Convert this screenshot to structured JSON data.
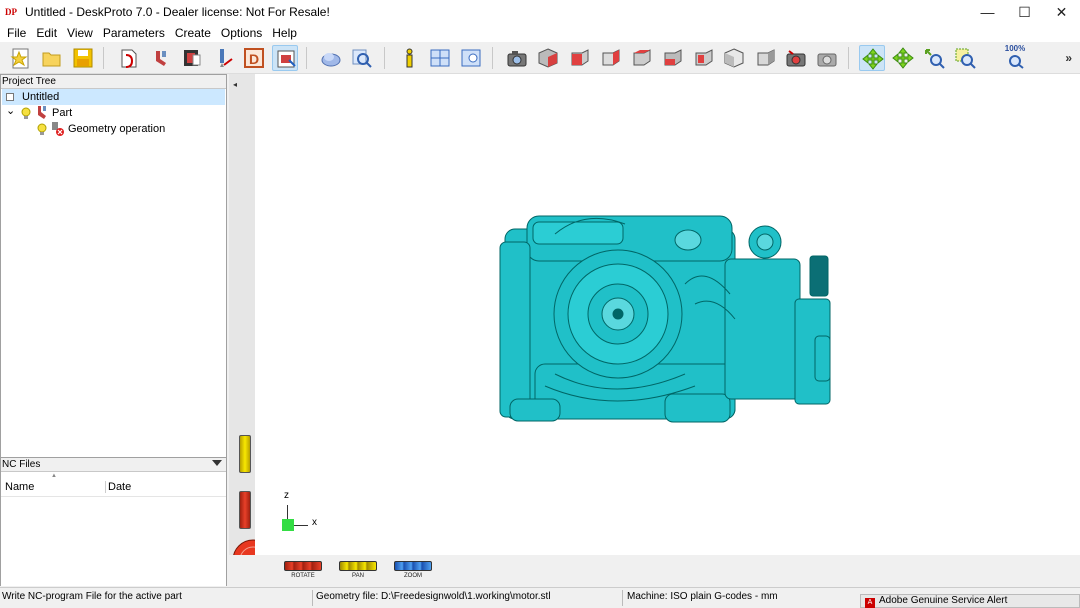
{
  "window": {
    "logo_text": "DP",
    "title": "Untitled - DeskProto 7.0 - Dealer license: Not For Resale!",
    "minimize": "—",
    "maximize": "☐",
    "close": "✕"
  },
  "menu": {
    "items": [
      "File",
      "Edit",
      "View",
      "Parameters",
      "Create",
      "Options",
      "Help"
    ]
  },
  "toolbar": {
    "zoom_100_label": "100%",
    "overflow": "»"
  },
  "project_tree": {
    "header": "Project Tree",
    "items": [
      {
        "label": "Untitled"
      },
      {
        "label": "Part",
        "expander": "⌄"
      },
      {
        "label": "Geometry operation"
      }
    ]
  },
  "nc_files": {
    "header": "NC Files",
    "columns": [
      "Name",
      "Date"
    ]
  },
  "viewport": {
    "collapse": "◂",
    "axis_z": "z",
    "axis_x": "x",
    "model_color": "#20c0c8"
  },
  "mouse_legend": {
    "rotate": "ROTATE",
    "pan": "PAN",
    "zoom": "ZOOM"
  },
  "status": {
    "hint": "Write NC-program File for the active part",
    "geometry": "Geometry file: D:\\Freedesignwold\\1.working\\motor.stl",
    "machine": "Machine: ISO plain G-codes - mm",
    "alert_icon": "A",
    "alert": "Adobe Genuine Service Alert"
  }
}
